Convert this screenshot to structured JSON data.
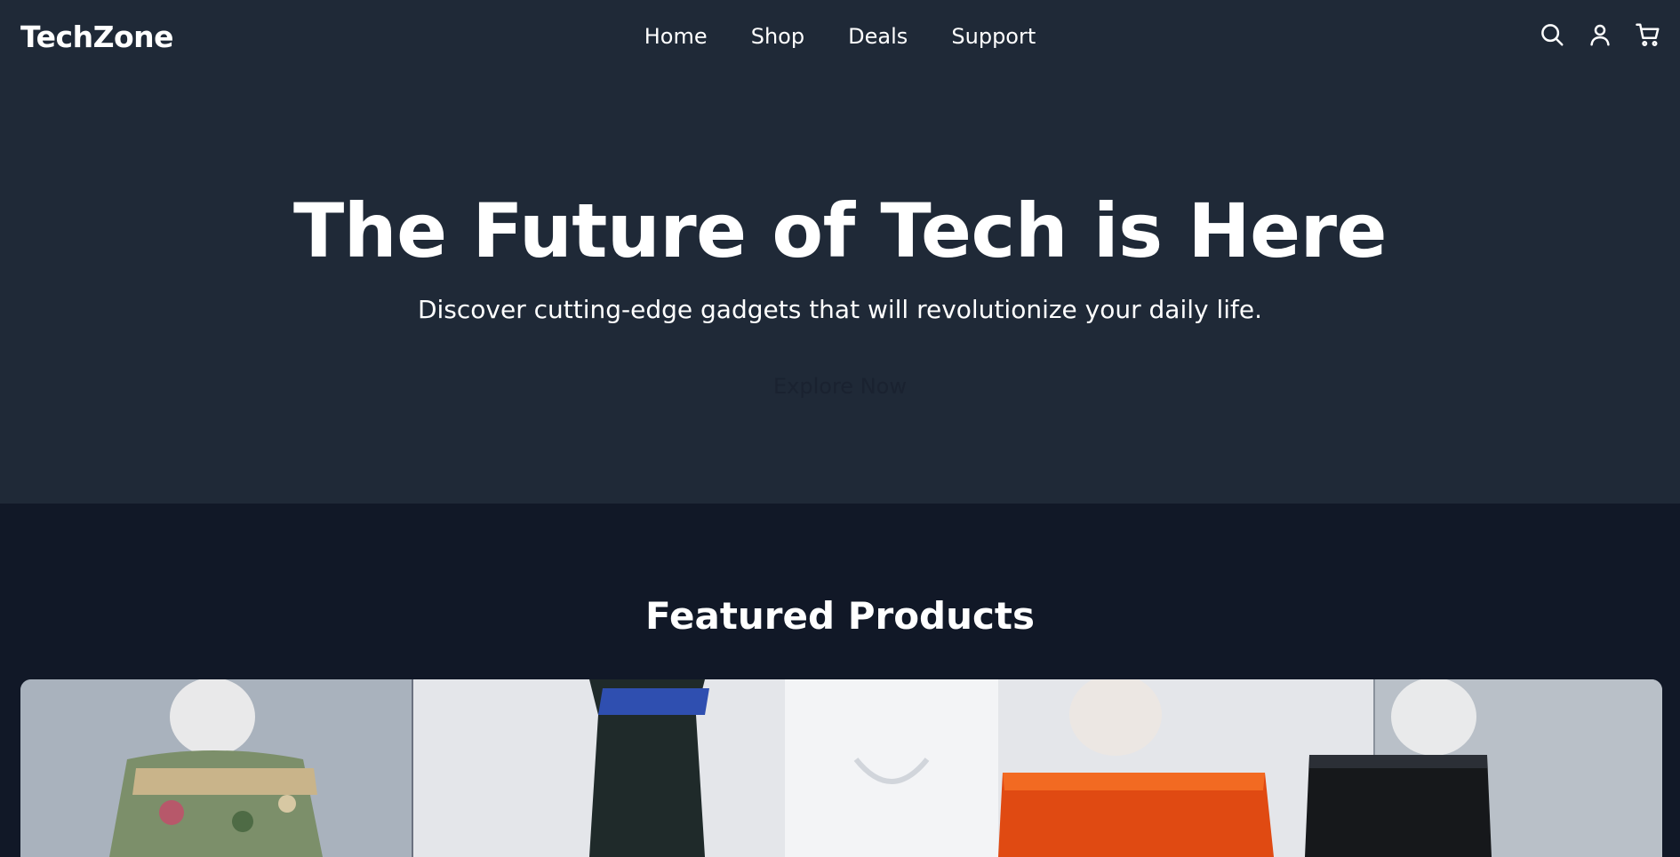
{
  "brand": {
    "name": "TechZone"
  },
  "nav": {
    "links": [
      "Home",
      "Shop",
      "Deals",
      "Support"
    ],
    "icons": [
      "search-icon",
      "user-icon",
      "cart-icon"
    ]
  },
  "hero": {
    "title": "The Future of Tech is Here",
    "subtitle": "Discover cutting-edge gadgets that will revolutionize your daily life.",
    "cta_label": "Explore Now"
  },
  "featured": {
    "title": "Featured Products",
    "banner_image": "mannequins-with-clothing-photo"
  },
  "colors": {
    "header_bg": "#1f2937",
    "page_bg": "#111827",
    "text": "#ffffff"
  }
}
